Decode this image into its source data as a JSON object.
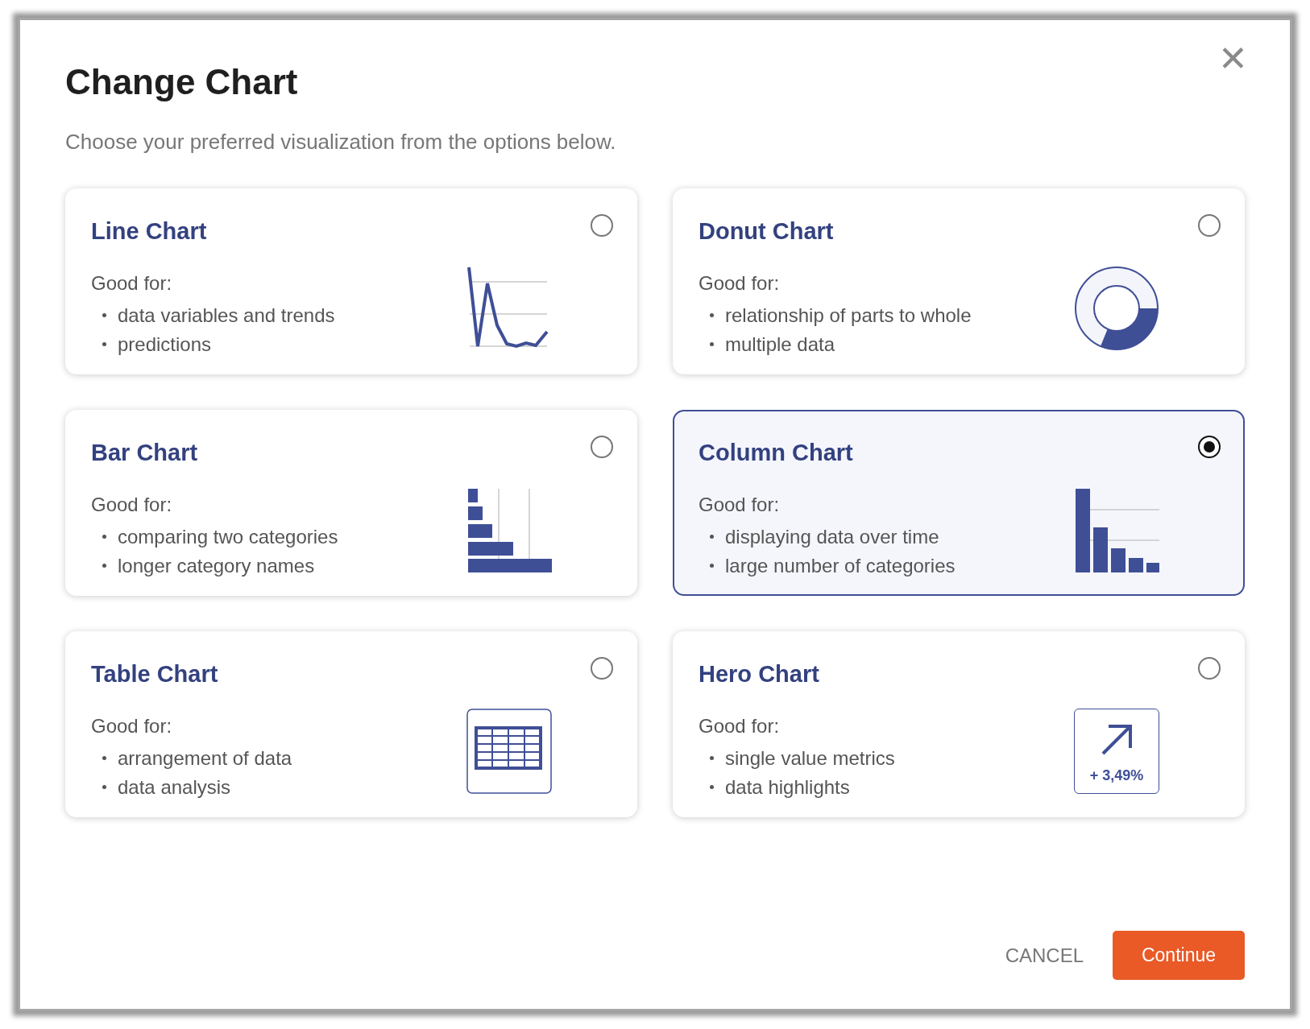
{
  "dialog": {
    "title": "Change Chart",
    "subtitle": "Choose your preferred visualization from the options below.",
    "close_label": "✕"
  },
  "options": [
    {
      "kind": "line",
      "title": "Line Chart",
      "heading": "Good for:",
      "points": [
        "data variables and trends",
        "predictions"
      ],
      "selected": false
    },
    {
      "kind": "donut",
      "title": "Donut Chart",
      "heading": "Good for:",
      "points": [
        "relationship of parts to whole",
        "multiple data"
      ],
      "selected": false
    },
    {
      "kind": "bar",
      "title": "Bar Chart",
      "heading": "Good for:",
      "points": [
        "comparing two categories",
        "longer category names"
      ],
      "selected": false
    },
    {
      "kind": "column",
      "title": "Column Chart",
      "heading": "Good for:",
      "points": [
        "displaying data over time",
        "large number of categories"
      ],
      "selected": true
    },
    {
      "kind": "table",
      "title": "Table Chart",
      "heading": "Good for:",
      "points": [
        "arrangement of data",
        "data analysis"
      ],
      "selected": false
    },
    {
      "kind": "hero",
      "title": "Hero Chart",
      "heading": "Good for:",
      "points": [
        "single value metrics",
        "data highlights"
      ],
      "selected": false,
      "icon_value": "+ 3,49%"
    }
  ],
  "buttons": {
    "cancel": "CANCEL",
    "continue": "Continue"
  }
}
